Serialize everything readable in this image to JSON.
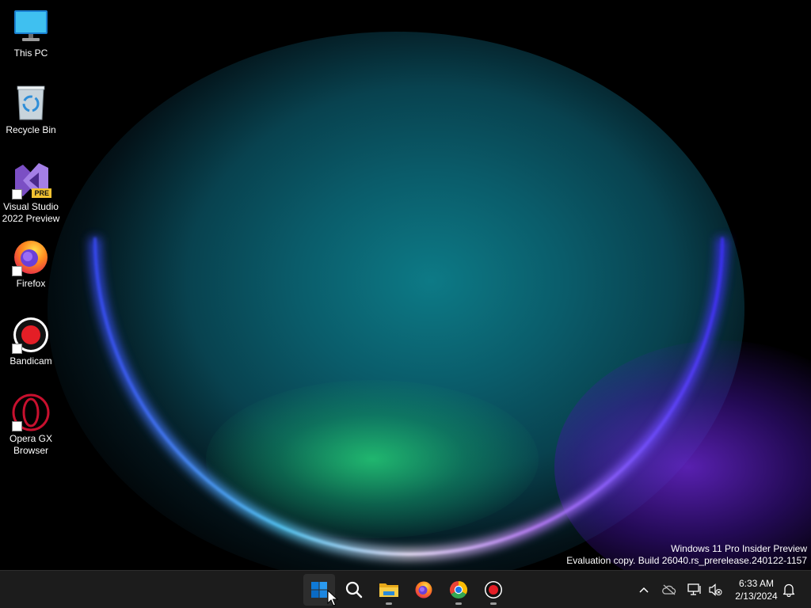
{
  "desktop": {
    "icons": [
      {
        "label": "This PC",
        "icon": "monitor-icon"
      },
      {
        "label": "Recycle Bin",
        "icon": "recycle-bin-icon"
      },
      {
        "label": "Visual Studio\n2022 Preview",
        "icon": "visual-studio-icon",
        "badge": "PRE"
      },
      {
        "label": "Firefox",
        "icon": "firefox-icon"
      },
      {
        "label": "Bandicam",
        "icon": "bandicam-icon"
      },
      {
        "label": "Opera GX\nBrowser",
        "icon": "opera-gx-icon"
      }
    ],
    "watermark": {
      "line1": "Windows 11 Pro Insider Preview",
      "line2": "Evaluation copy. Build 26040.rs_prerelease.240122-1157"
    }
  },
  "taskbar": {
    "apps": [
      {
        "name": "Start",
        "icon": "windows-start-icon",
        "active": true
      },
      {
        "name": "Search",
        "icon": "search-icon"
      },
      {
        "name": "File Explorer",
        "icon": "folder-icon",
        "running": true
      },
      {
        "name": "Firefox",
        "icon": "firefox-icon"
      },
      {
        "name": "Google Chrome",
        "icon": "chrome-icon",
        "running": true
      },
      {
        "name": "Bandicam",
        "icon": "bandicam-icon",
        "running": true
      }
    ],
    "tray": {
      "icons": [
        "chevron-up-icon",
        "onedrive-offline-icon",
        "network-icon",
        "volume-muted-icon",
        "notification-bell-icon"
      ]
    },
    "clock": {
      "time": "6:33 AM",
      "date": "2/13/2024"
    }
  },
  "colors": {
    "taskbar_bg": "#1c1c1c",
    "start_blue": "#0078d4",
    "bandicam_red": "#e41e26",
    "opera_red": "#c8102e"
  }
}
